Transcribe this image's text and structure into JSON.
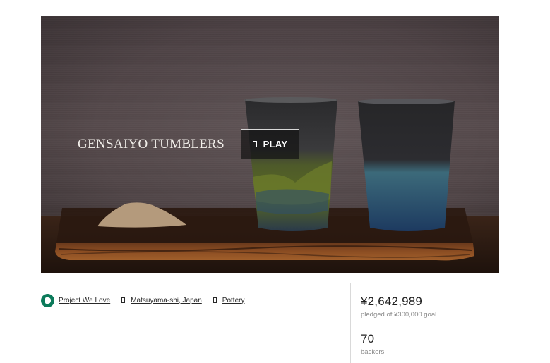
{
  "hero": {
    "title": "GENSAIYO TUMBLERS",
    "play_label": "PLAY",
    "play_icon": "play-icon"
  },
  "meta": {
    "badge_icon": "project-we-love-icon",
    "badge_color": "#0b7a5a",
    "project_we_love": "Project We Love",
    "location_icon": "location-icon",
    "location": "Matsuyama-shi, Japan",
    "category_icon": "category-icon",
    "category": "Pottery"
  },
  "stats": {
    "pledged_amount": "¥2,642,989",
    "pledged_label": "pledged of ¥300,000 goal",
    "backers_count": "70",
    "backers_label": "backers"
  }
}
